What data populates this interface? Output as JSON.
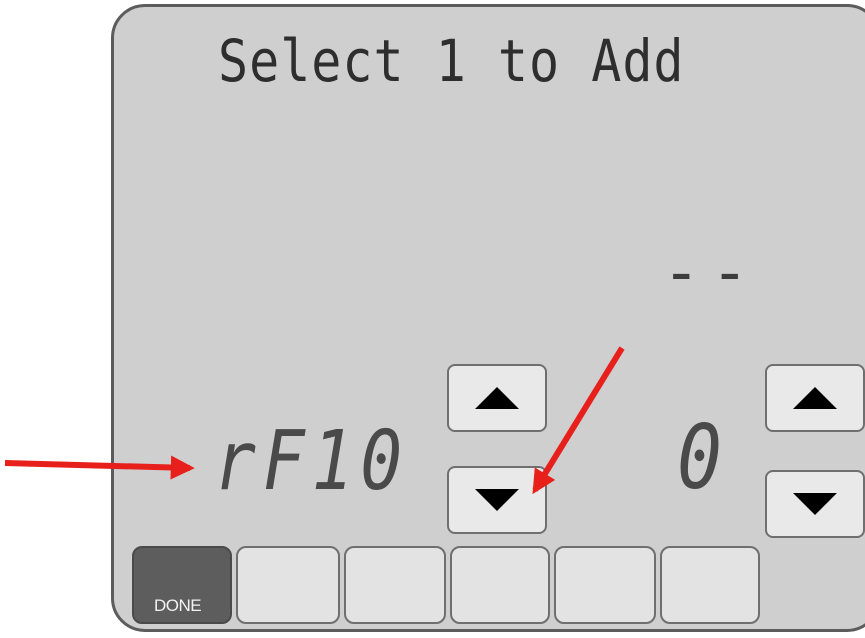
{
  "screen": {
    "title": "Select 1 to Add",
    "value_placeholder": "--",
    "parameter_code": "rF10",
    "parameter_value": "0"
  },
  "controls": {
    "param_up": "arrow-up-icon",
    "param_down": "arrow-down-icon",
    "value_up": "arrow-up-icon",
    "value_down": "arrow-down-icon"
  },
  "softkeys": {
    "done_label": "DONE",
    "blank_count": 5
  },
  "annotations": {
    "arrow_color": "#e8201c",
    "targets": [
      "parameter-code",
      "param-down-button"
    ]
  }
}
